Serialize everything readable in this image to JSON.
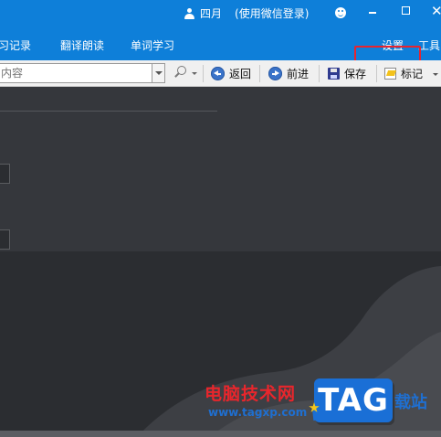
{
  "titlebar": {
    "username": "四月",
    "login_note": "(使用微信登录)",
    "close_glyph": "✕"
  },
  "menubar": {
    "items": [
      {
        "id": "record",
        "label": "习记录"
      },
      {
        "id": "translate",
        "label": "翻译朗读"
      },
      {
        "id": "words",
        "label": "单词学习"
      },
      {
        "id": "settings",
        "label": "设置"
      },
      {
        "id": "tools",
        "label": "工具"
      }
    ],
    "highlight_color": "#e8242e"
  },
  "toolbar": {
    "search_placeholder": "内容",
    "back_label": "返回",
    "forward_label": "前进",
    "save_label": "保存",
    "mark_label": "标记"
  },
  "watermark": {
    "site_name": "电脑技术网",
    "url": "www.tagxp.com",
    "logo_text": "TAG",
    "suffix": "载站"
  },
  "colors": {
    "accent": "#0e7fd9",
    "content_bg": "#2b2d31",
    "highlight": "#e8242e"
  }
}
